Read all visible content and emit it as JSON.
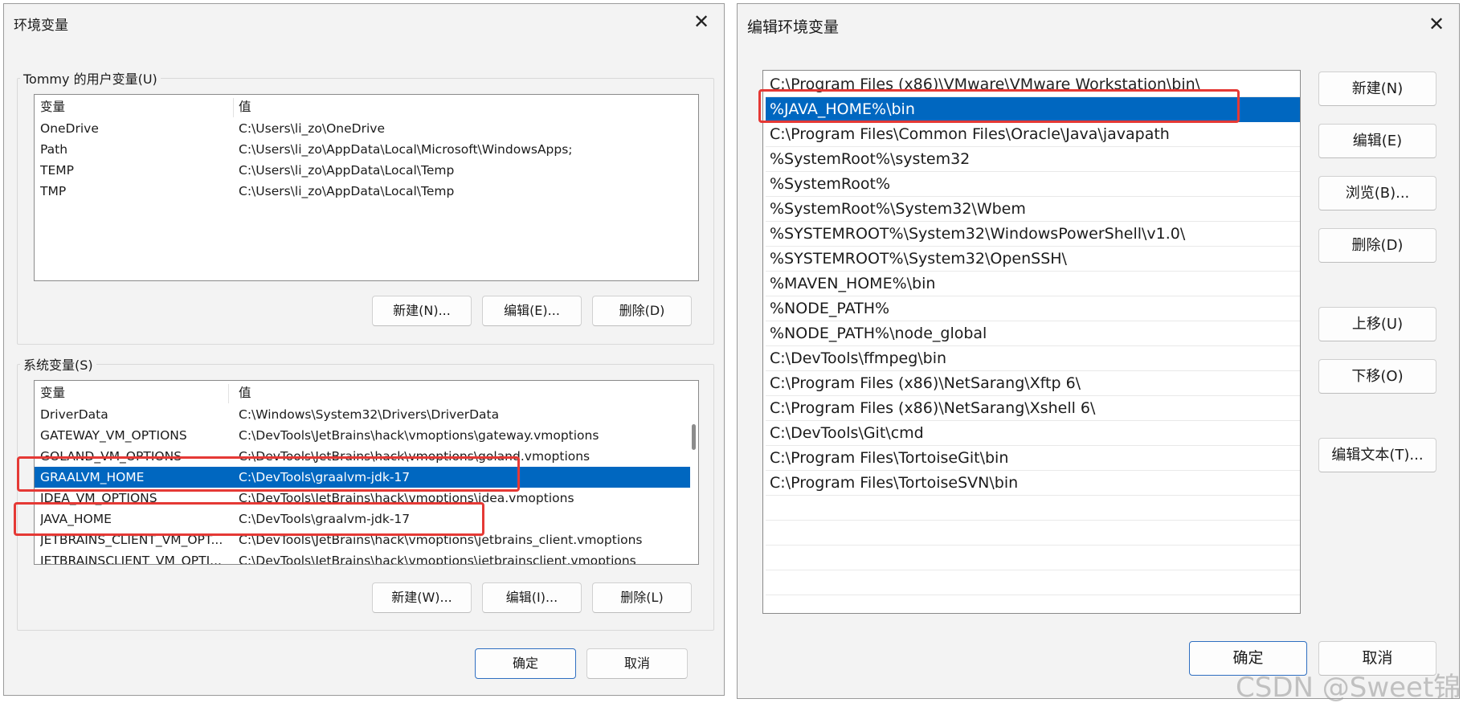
{
  "left_dialog": {
    "title": "环境变量",
    "close_glyph": "✕",
    "user_group": {
      "legend": "Tommy 的用户变量(U)",
      "col_var": "变量",
      "col_val": "值",
      "rows": [
        {
          "name": "OneDrive",
          "value": "C:\\Users\\li_zo\\OneDrive"
        },
        {
          "name": "Path",
          "value": "C:\\Users\\li_zo\\AppData\\Local\\Microsoft\\WindowsApps;"
        },
        {
          "name": "TEMP",
          "value": "C:\\Users\\li_zo\\AppData\\Local\\Temp"
        },
        {
          "name": "TMP",
          "value": "C:\\Users\\li_zo\\AppData\\Local\\Temp"
        }
      ],
      "btn_new": "新建(N)...",
      "btn_edit": "编辑(E)...",
      "btn_delete": "删除(D)"
    },
    "system_group": {
      "legend": "系统变量(S)",
      "col_var": "变量",
      "col_val": "值",
      "rows": [
        {
          "name": "DriverData",
          "value": "C:\\Windows\\System32\\Drivers\\DriverData"
        },
        {
          "name": "GATEWAY_VM_OPTIONS",
          "value": "C:\\DevTools\\JetBrains\\hack\\vmoptions\\gateway.vmoptions"
        },
        {
          "name": "GOLAND_VM_OPTIONS",
          "value": "C:\\DevTools\\JetBrains\\hack\\vmoptions\\goland.vmoptions"
        },
        {
          "name": "GRAALVM_HOME",
          "value": "C:\\DevTools\\graalvm-jdk-17"
        },
        {
          "name": "IDEA_VM_OPTIONS",
          "value": "C:\\DevTools\\JetBrains\\hack\\vmoptions\\idea.vmoptions"
        },
        {
          "name": "JAVA_HOME",
          "value": "C:\\DevTools\\graalvm-jdk-17"
        },
        {
          "name": "JETBRAINS_CLIENT_VM_OPT...",
          "value": "C:\\DevTools\\JetBrains\\hack\\vmoptions\\jetbrains_client.vmoptions"
        },
        {
          "name": "JETBRAINSCLIENT_VM_OPTI...",
          "value": "C:\\DevTools\\JetBrains\\hack\\vmoptions\\jetbrainsclient.vmoptions"
        }
      ],
      "btn_new": "新建(W)...",
      "btn_edit": "编辑(I)...",
      "btn_delete": "删除(L)"
    },
    "btn_ok": "确定",
    "btn_cancel": "取消"
  },
  "right_dialog": {
    "title": "编辑环境变量",
    "close_glyph": "✕",
    "paths": [
      "C:\\Program Files (x86)\\VMware\\VMware Workstation\\bin\\",
      "%JAVA_HOME%\\bin",
      "C:\\Program Files\\Common Files\\Oracle\\Java\\javapath",
      "%SystemRoot%\\system32",
      "%SystemRoot%",
      "%SystemRoot%\\System32\\Wbem",
      "%SYSTEMROOT%\\System32\\WindowsPowerShell\\v1.0\\",
      "%SYSTEMROOT%\\System32\\OpenSSH\\",
      "%MAVEN_HOME%\\bin",
      "%NODE_PATH%",
      "%NODE_PATH%\\node_global",
      "C:\\DevTools\\ffmpeg\\bin",
      "C:\\Program Files (x86)\\NetSarang\\Xftp 6\\",
      "C:\\Program Files (x86)\\NetSarang\\Xshell 6\\",
      "C:\\DevTools\\Git\\cmd",
      "C:\\Program Files\\TortoiseGit\\bin",
      "C:\\Program Files\\TortoiseSVN\\bin",
      "",
      "",
      "",
      "",
      ""
    ],
    "btn_new": "新建(N)",
    "btn_edit": "编辑(E)",
    "btn_browse": "浏览(B)...",
    "btn_delete": "删除(D)",
    "btn_up": "上移(U)",
    "btn_down": "下移(O)",
    "btn_edit_text": "编辑文本(T)...",
    "btn_ok": "确定",
    "btn_cancel": "取消"
  },
  "watermark": "CSDN @Sweet锦",
  "colors": {
    "selection": "#0067c0",
    "highlight_box": "#e53935",
    "dialog_bg": "#f3f3f3",
    "primary_border": "#2f6fc1"
  }
}
